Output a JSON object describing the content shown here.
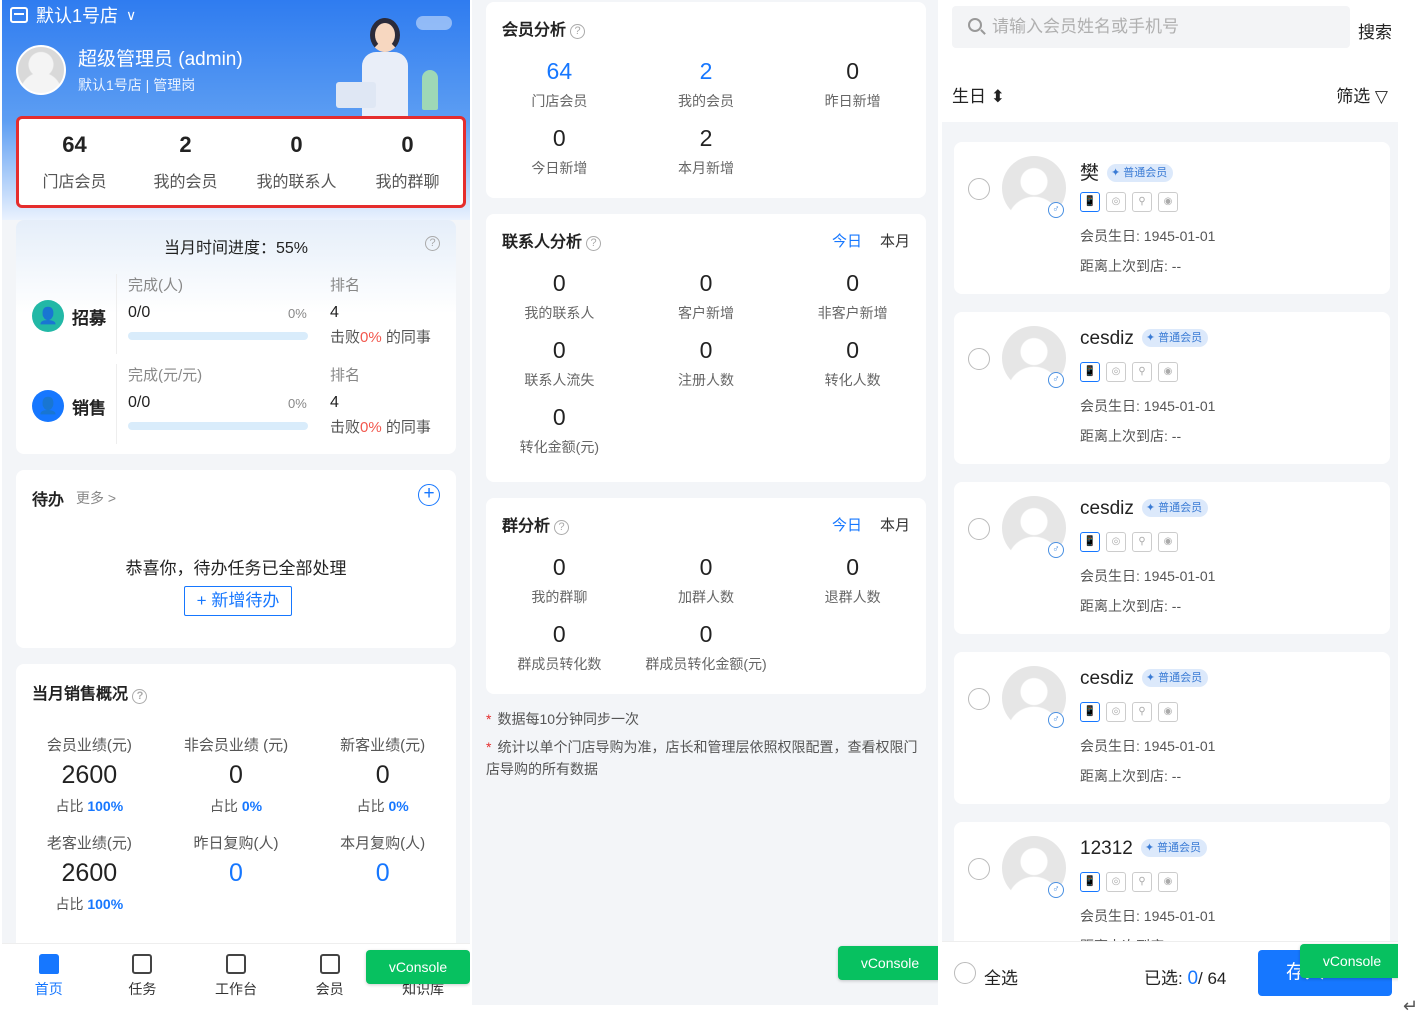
{
  "home": {
    "store_name": "默认1号店",
    "user_name": "超级管理员 (admin)",
    "user_sub": "默认1号店 | 管理岗",
    "top_stats": [
      {
        "value": "64",
        "label": "门店会员"
      },
      {
        "value": "2",
        "label": "我的会员"
      },
      {
        "value": "0",
        "label": "我的联系人"
      },
      {
        "value": "0",
        "label": "我的群聊"
      }
    ],
    "progress": {
      "title": "当月时间进度：55%",
      "rows": [
        {
          "name": "招募",
          "done_label": "完成(人)",
          "done_value": "0/0",
          "percent": "0%",
          "rank_label": "排名",
          "rank_value": "4",
          "beat_prefix": "击败",
          "beat_pct": "0%",
          "beat_suffix": " 的同事",
          "badge_color": "#22b8a6"
        },
        {
          "name": "销售",
          "done_label": "完成(元/元)",
          "done_value": "0/0",
          "percent": "0%",
          "rank_label": "排名",
          "rank_value": "4",
          "beat_prefix": "击败",
          "beat_pct": "0%",
          "beat_suffix": " 的同事",
          "badge_color": "#1677ff"
        }
      ]
    },
    "todo": {
      "title": "待办",
      "more": "更多 >",
      "message": "恭喜你，待办任务已全部处理",
      "add": "+ 新增待办"
    },
    "sales": {
      "title": "当月销售概况",
      "cells": [
        {
          "label": "会员业绩(元)",
          "value": "2600",
          "ratio_prefix": "占比 ",
          "ratio": "100%",
          "blue_value": false
        },
        {
          "label": "非会员业绩 (元)",
          "value": "0",
          "ratio_prefix": "占比 ",
          "ratio": "0%",
          "blue_value": false
        },
        {
          "label": "新客业绩(元)",
          "value": "0",
          "ratio_prefix": "占比 ",
          "ratio": "0%",
          "blue_value": false
        },
        {
          "label": "老客业绩(元)",
          "value": "2600",
          "ratio_prefix": "占比 ",
          "ratio": "100%",
          "blue_value": false
        },
        {
          "label": "昨日复购(人)",
          "value": "0",
          "ratio_prefix": "",
          "ratio": "",
          "blue_value": true
        },
        {
          "label": "本月复购(人)",
          "value": "0",
          "ratio_prefix": "",
          "ratio": "",
          "blue_value": true
        }
      ]
    },
    "tabs": [
      "首页",
      "任务",
      "工作台",
      "会员",
      "知识库"
    ],
    "vconsole": "vConsole"
  },
  "analysis": {
    "member": {
      "title": "会员分析",
      "cells": [
        {
          "value": "64",
          "label": "门店会员",
          "blue": true
        },
        {
          "value": "2",
          "label": "我的会员",
          "blue": true
        },
        {
          "value": "0",
          "label": "昨日新增",
          "blue": false
        },
        {
          "value": "0",
          "label": "今日新增",
          "blue": false
        },
        {
          "value": "2",
          "label": "本月新增",
          "blue": false
        }
      ]
    },
    "contact": {
      "title": "联系人分析",
      "seg": [
        "今日",
        "本月"
      ],
      "cells": [
        {
          "value": "0",
          "label": "我的联系人"
        },
        {
          "value": "0",
          "label": "客户新增"
        },
        {
          "value": "0",
          "label": "非客户新增"
        },
        {
          "value": "0",
          "label": "联系人流失"
        },
        {
          "value": "0",
          "label": "注册人数"
        },
        {
          "value": "0",
          "label": "转化人数"
        },
        {
          "value": "0",
          "label": "转化金额(元)"
        }
      ]
    },
    "group": {
      "title": "群分析",
      "seg": [
        "今日",
        "本月"
      ],
      "cells": [
        {
          "value": "0",
          "label": "我的群聊"
        },
        {
          "value": "0",
          "label": "加群人数"
        },
        {
          "value": "0",
          "label": "退群人数"
        },
        {
          "value": "0",
          "label": "群成员转化数"
        },
        {
          "value": "0",
          "label": "群成员转化金额(元)"
        }
      ]
    },
    "notes": [
      "数据每10分钟同步一次",
      "统计以单个门店导购为准，店长和管理层依照权限配置，查看权限门店导购的所有数据"
    ],
    "vconsole": "vConsole"
  },
  "members": {
    "search_placeholder": "请输入会员姓名或手机号",
    "search_btn": "搜索",
    "sort_label": "生日 ⬍",
    "filter_label": "筛选 ▽",
    "tier": "普通会员",
    "channels": [
      "📱",
      "◎",
      "⚲",
      "◉"
    ],
    "list": [
      {
        "name": "樊",
        "birth": "会员生日: 1945-01-01",
        "last": "距离上次到店: --"
      },
      {
        "name": "cesdiz",
        "birth": "会员生日: 1945-01-01",
        "last": "距离上次到店: --"
      },
      {
        "name": "cesdiz",
        "birth": "会员生日: 1945-01-01",
        "last": "距离上次到店: --"
      },
      {
        "name": "cesdiz",
        "birth": "会员生日: 1945-01-01",
        "last": "距离上次到店: --"
      },
      {
        "name": "12312",
        "birth": "会员生日: 1945-01-01",
        "last": "距离上次到店: --"
      }
    ],
    "select_all": "全选",
    "selected_prefix": "已选: ",
    "selected_count": "0",
    "selected_total": "/ 64",
    "save_btn": "存入",
    "vconsole": "vConsole",
    "enter_glyph": "↵"
  }
}
